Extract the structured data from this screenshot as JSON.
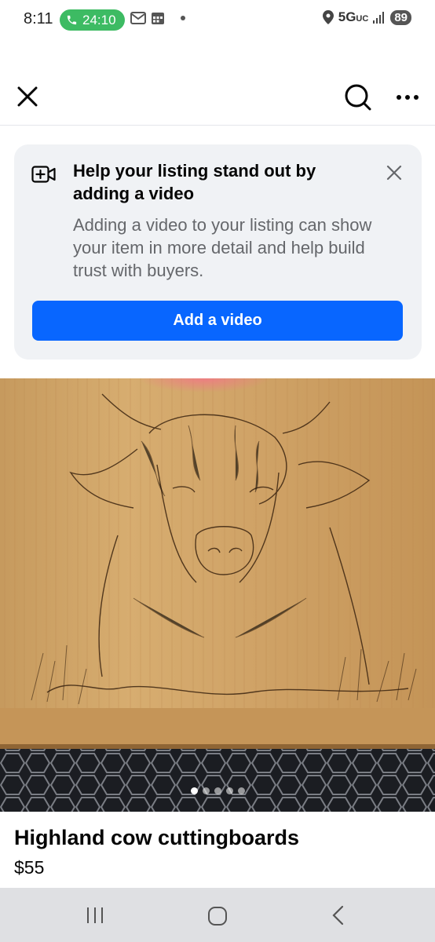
{
  "status_bar": {
    "time": "8:11",
    "call_timer": "24:10",
    "network": "5G",
    "network_sub": "UC",
    "battery": "89"
  },
  "header": {
    "close_icon": "close-icon",
    "search_icon": "search-icon",
    "more_icon": "more-options-icon"
  },
  "promo": {
    "icon": "add-video-icon",
    "title": "Help your listing stand out by adding a video",
    "body": "Adding a video to your listing can show your item in more detail and help build trust with buyers.",
    "button_label": "Add a video"
  },
  "gallery": {
    "photo_count": 5,
    "active_index": 0
  },
  "listing": {
    "title": "Highland cow cuttingboards",
    "price": "$55"
  },
  "colors": {
    "accent": "#0866ff",
    "call_pill": "#3dbb63",
    "card_bg": "#f0f2f5",
    "secondary_text": "#65676b"
  }
}
